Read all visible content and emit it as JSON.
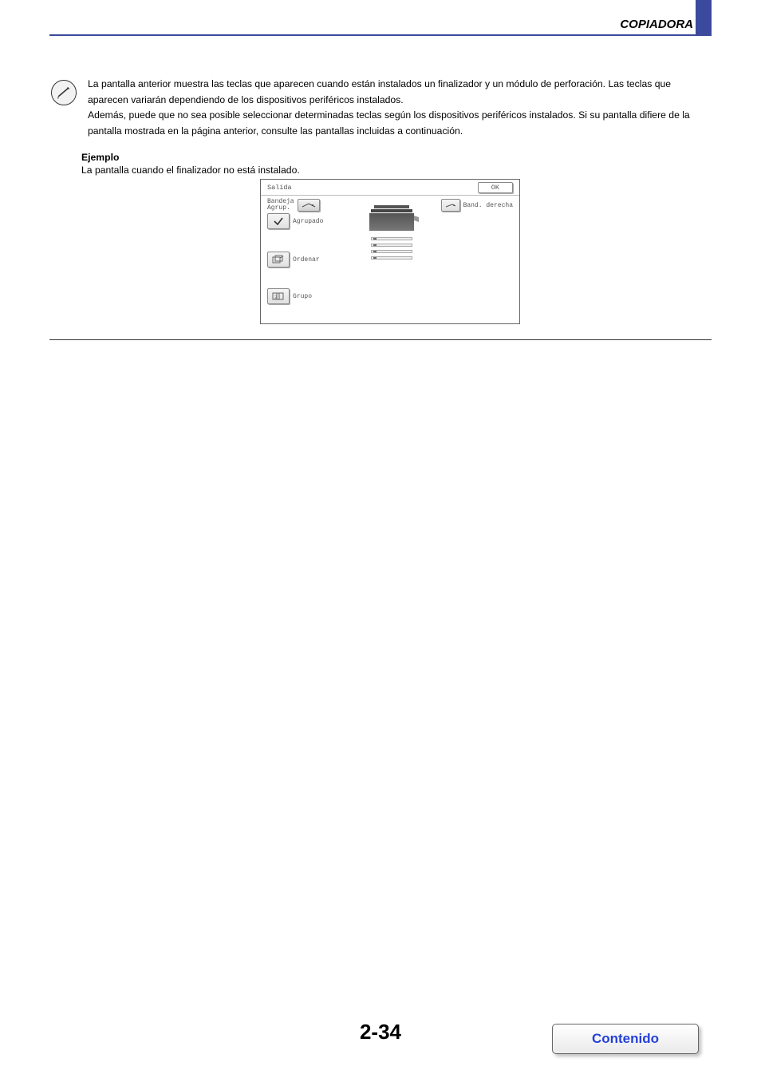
{
  "header": {
    "title": "COPIADORA"
  },
  "info": {
    "text": "La pantalla anterior muestra las teclas que aparecen cuando están instalados un finalizador y un módulo de perforación. Las teclas que aparecen variarán dependiendo de los dispositivos periféricos instalados.\nAdemás, puede que no sea posible seleccionar determinadas teclas según los dispositivos periféricos instalados. Si su pantalla difiere de la pantalla mostrada en la página anterior, consulte las pantallas incluidas a continuación."
  },
  "example": {
    "label": "Ejemplo",
    "caption": "La pantalla cuando el finalizador no está instalado."
  },
  "figure": {
    "title": "Salida",
    "ok": "OK",
    "out_tray": {
      "line1": "Bandeja",
      "line2": "Agrup."
    },
    "grouped": "Agrupado",
    "sort": "Ordenar",
    "group": "Grupo",
    "right_tray": "Band. derecha"
  },
  "page_number": "2-34",
  "contents_button": "Contenido"
}
